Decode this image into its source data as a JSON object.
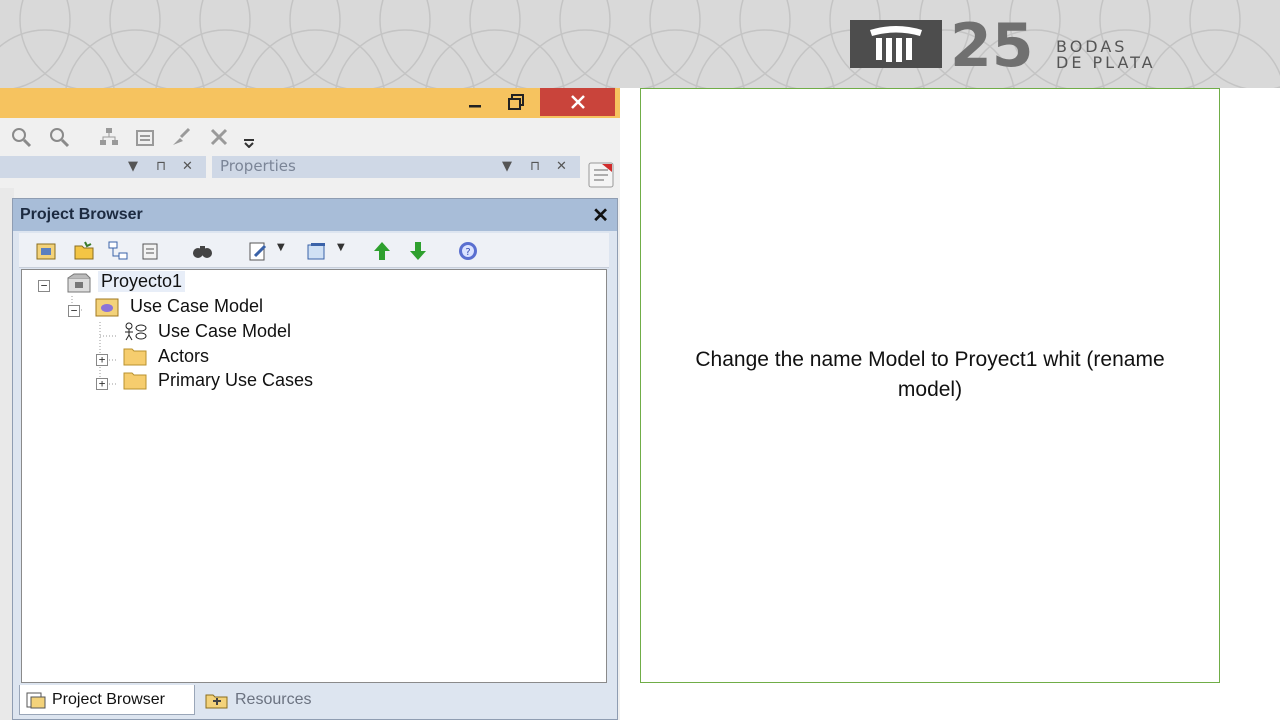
{
  "banner": {
    "logo_number": "25",
    "logo_line1": "BODAS",
    "logo_line2": "DE PLATA"
  },
  "app_window": {
    "minimize_icon": "minimize-icon",
    "maximize_icon": "restore-icon",
    "close_icon": "close-icon",
    "properties_panel_title": "Properties"
  },
  "project_browser": {
    "title": "Project Browser",
    "close_label": "✕",
    "tree": {
      "root": {
        "label": "Proyecto1",
        "expanded": true
      },
      "child": {
        "label": "Use Case Model",
        "expanded": true
      },
      "items": [
        {
          "label": "Use Case Model",
          "icon": "use-case-diagram-icon"
        },
        {
          "label": "Actors",
          "icon": "folder-icon"
        },
        {
          "label": "Primary Use Cases",
          "icon": "folder-icon"
        }
      ]
    },
    "tabs": [
      {
        "label": "Project Browser",
        "active": true
      },
      {
        "label": "Resources",
        "active": false
      }
    ]
  },
  "instruction": {
    "text": "Change the name Model to Proyect1 whit (rename model)"
  },
  "colors": {
    "banner_bg": "#d9d9d9",
    "titlebar": "#f6c35f",
    "close_button": "#c9443b",
    "panel_header": "#a8bdd8",
    "instruction_border": "#70ad47"
  }
}
